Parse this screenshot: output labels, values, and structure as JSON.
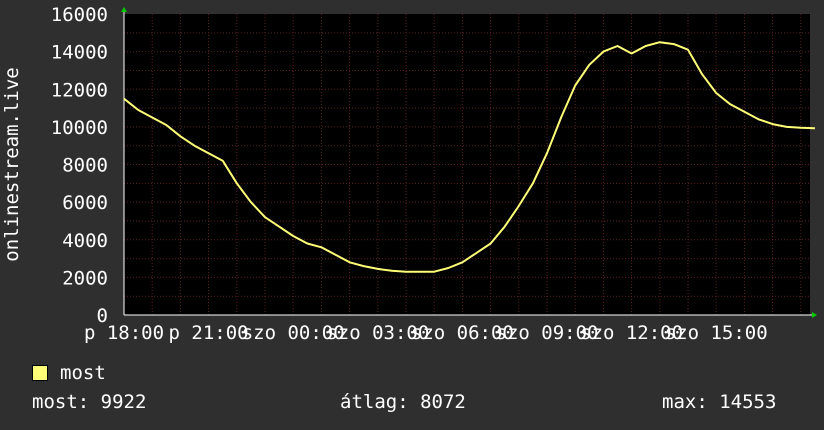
{
  "chart_data": {
    "type": "line",
    "ylabel": "onlinestream.live",
    "ylim": [
      0,
      16000
    ],
    "yticks": [
      0,
      2000,
      4000,
      6000,
      8000,
      10000,
      12000,
      14000,
      16000
    ],
    "xticks": [
      "p 18:00",
      "p 21:00",
      "szo 00:00",
      "szo 03:00",
      "szo 06:00",
      "szo 09:00",
      "szo 12:00",
      "szo 15:00"
    ],
    "grid": true,
    "series": [
      {
        "name": "most",
        "color": "#ffff77",
        "x_hours": [
          0,
          0.5,
          1,
          1.5,
          2,
          2.5,
          3,
          3.5,
          4,
          4.5,
          5,
          5.5,
          6,
          6.5,
          7,
          7.5,
          8,
          8.5,
          9,
          9.5,
          10,
          10.5,
          11,
          11.5,
          12,
          12.5,
          13,
          13.5,
          14,
          14.5,
          15,
          15.5,
          16,
          16.5,
          17,
          17.5,
          18,
          18.5,
          19,
          19.5,
          20,
          20.5,
          21,
          21.5,
          22,
          22.5,
          23,
          23.5,
          24,
          24.5
        ],
        "values": [
          11500,
          10900,
          10500,
          10100,
          9500,
          9000,
          8600,
          8200,
          7000,
          6000,
          5200,
          4700,
          4200,
          3800,
          3600,
          3200,
          2800,
          2600,
          2450,
          2350,
          2300,
          2300,
          2300,
          2500,
          2800,
          3300,
          3800,
          4700,
          5800,
          7000,
          8600,
          10500,
          12200,
          13300,
          14000,
          14300,
          13900,
          14300,
          14500,
          14400,
          14100,
          12800,
          11800,
          11200,
          10800,
          10400,
          10150,
          10000,
          9950,
          9922
        ]
      }
    ],
    "background": "#000000",
    "gridColor": "#5a1f1f",
    "axisColor": "#ffffff"
  },
  "legend": {
    "label": "most",
    "color": "#ffff77"
  },
  "stats": {
    "current": "most: 9922",
    "average": "átlag: 8072",
    "max": "max: 14553"
  }
}
